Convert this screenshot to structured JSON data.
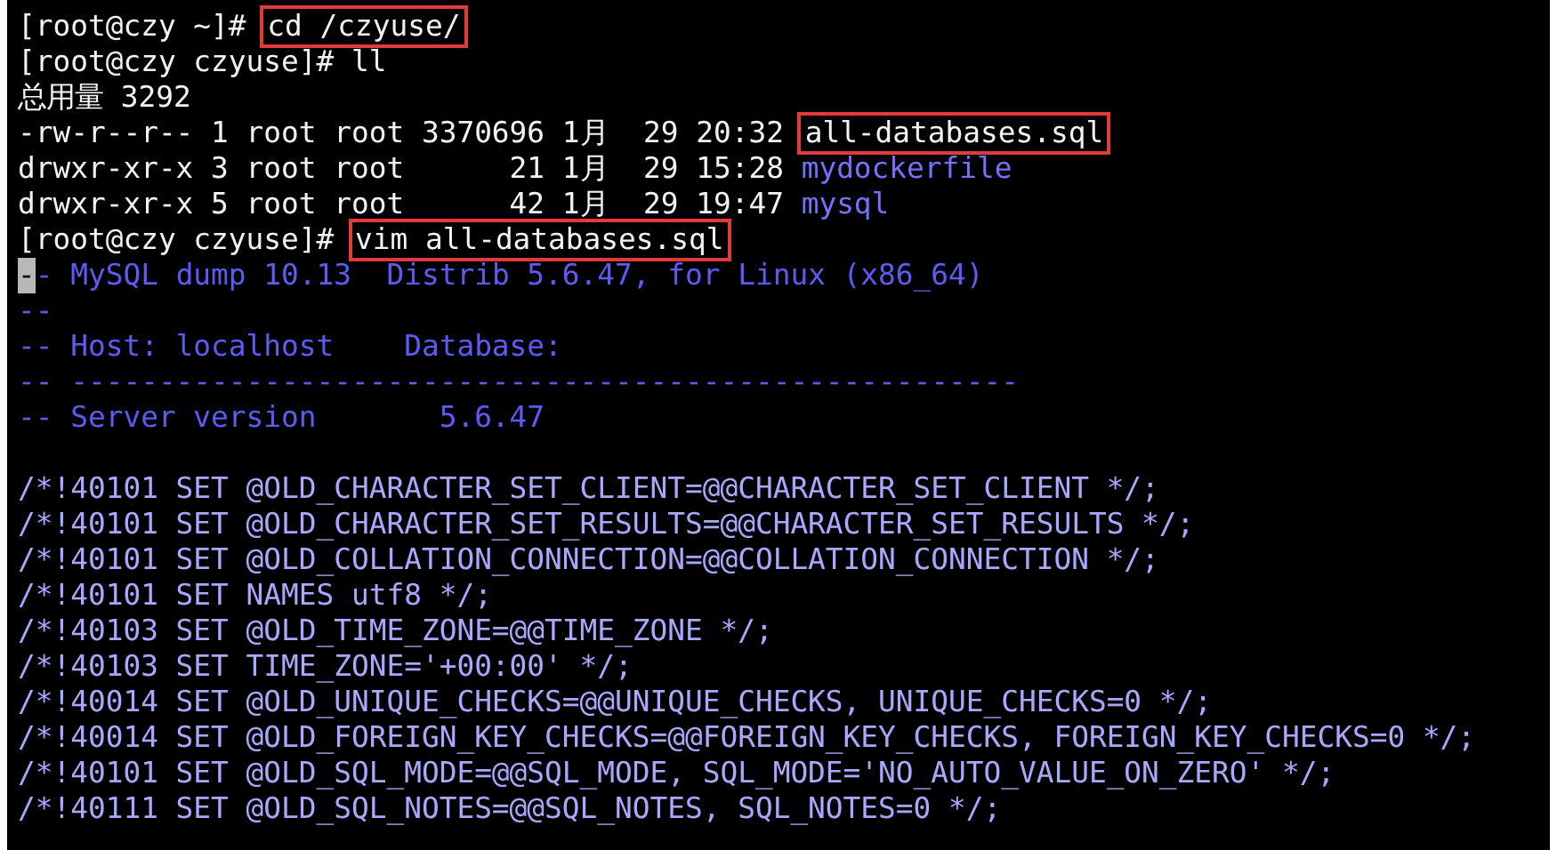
{
  "terminal": {
    "sections": [
      {
        "lines": [
          {
            "segments": [
              {
                "kind": "plain",
                "text": "[root@czy ~]# "
              },
              {
                "kind": "boxed",
                "text": "cd /czyuse/"
              }
            ]
          },
          {
            "segments": [
              {
                "kind": "plain",
                "text": "[root@czy czyuse]# ll"
              }
            ]
          },
          {
            "segments": [
              {
                "kind": "plain",
                "text": "总用量 3292"
              }
            ]
          },
          {
            "segments": [
              {
                "kind": "plain",
                "text": "-rw-r--r-- 1 root root 3370696 1月  29 20:32 "
              },
              {
                "kind": "boxed",
                "text": "all-databases.sql"
              }
            ]
          },
          {
            "segments": [
              {
                "kind": "plain",
                "text": "drwxr-xr-x 3 root root      21 1月  29 15:28 "
              },
              {
                "kind": "dir",
                "text": "mydockerfile"
              }
            ]
          },
          {
            "segments": [
              {
                "kind": "plain",
                "text": "drwxr-xr-x 5 root root      42 1月  29 19:47 "
              },
              {
                "kind": "dir",
                "text": "mysql"
              }
            ]
          },
          {
            "segments": [
              {
                "kind": "plain",
                "text": "[root@czy czyuse]# "
              },
              {
                "kind": "boxed",
                "text": "vim all-databases.sql"
              }
            ]
          },
          {
            "segments": [
              {
                "kind": "cursor",
                "text": "-"
              },
              {
                "kind": "comment",
                "text": "- MySQL dump 10.13  Distrib 5.6.47, for Linux (x86_64)"
              }
            ]
          },
          {
            "segments": [
              {
                "kind": "comment",
                "text": "--"
              }
            ]
          },
          {
            "segments": [
              {
                "kind": "comment",
                "text": "-- Host: localhost    Database:"
              }
            ]
          },
          {
            "segments": [
              {
                "kind": "comment",
                "text": "-- ------------------------------------------------------"
              }
            ]
          },
          {
            "segments": [
              {
                "kind": "comment",
                "text": "-- Server version       5.6.47"
              }
            ]
          }
        ]
      },
      {
        "lines": [
          {
            "segments": [
              {
                "kind": "directive",
                "text": "/*!40101 SET @OLD_CHARACTER_SET_CLIENT=@@CHARACTER_SET_CLIENT */;"
              }
            ]
          },
          {
            "segments": [
              {
                "kind": "directive",
                "text": "/*!40101 SET @OLD_CHARACTER_SET_RESULTS=@@CHARACTER_SET_RESULTS */;"
              }
            ]
          },
          {
            "segments": [
              {
                "kind": "directive",
                "text": "/*!40101 SET @OLD_COLLATION_CONNECTION=@@COLLATION_CONNECTION */;"
              }
            ]
          },
          {
            "segments": [
              {
                "kind": "directive",
                "text": "/*!40101 SET NAMES utf8 */;"
              }
            ]
          },
          {
            "segments": [
              {
                "kind": "directive",
                "text": "/*!40103 SET @OLD_TIME_ZONE=@@TIME_ZONE */;"
              }
            ]
          },
          {
            "segments": [
              {
                "kind": "directive",
                "text": "/*!40103 SET TIME_ZONE='+00:00' */;"
              }
            ]
          },
          {
            "segments": [
              {
                "kind": "directive",
                "text": "/*!40014 SET @OLD_UNIQUE_CHECKS=@@UNIQUE_CHECKS, UNIQUE_CHECKS=0 */;"
              }
            ]
          },
          {
            "segments": [
              {
                "kind": "directive",
                "text": "/*!40014 SET @OLD_FOREIGN_KEY_CHECKS=@@FOREIGN_KEY_CHECKS, FOREIGN_KEY_CHECKS=0 */;"
              }
            ]
          },
          {
            "segments": [
              {
                "kind": "directive",
                "text": "/*!40101 SET @OLD_SQL_MODE=@@SQL_MODE, SQL_MODE='NO_AUTO_VALUE_ON_ZERO' */;"
              }
            ]
          },
          {
            "segments": [
              {
                "kind": "directive",
                "text": "/*!40111 SET @OLD_SQL_NOTES=@@SQL_NOTES, SQL_NOTES=0 */;"
              }
            ]
          }
        ]
      }
    ]
  }
}
